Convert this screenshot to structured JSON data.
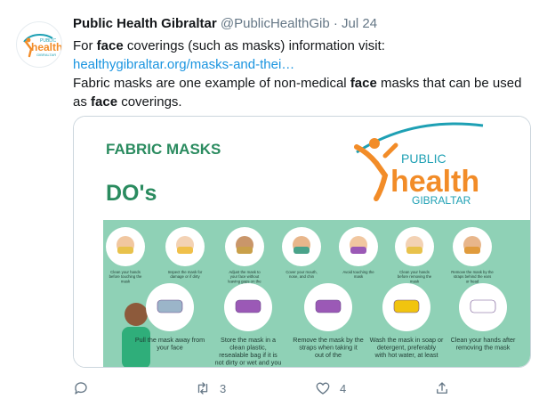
{
  "tweet": {
    "display_name": "Public Health Gibraltar",
    "handle": "@PublicHealthGib",
    "separator": "·",
    "date": "Jul 24",
    "line1_pre": "For ",
    "line1_bold": "face",
    "line1_post": " coverings (such as masks) information visit:",
    "link_text": "healthygibraltar.org/masks-and-thei…",
    "line3_pre": "Fabric masks are one example of non-medical ",
    "line3_bold1": "face",
    "line3_mid": " masks that can be used as ",
    "line3_bold2": "face",
    "line3_post": " coverings."
  },
  "avatar": {
    "logo_small": "PUBLIC",
    "logo_main": "health",
    "logo_sub": "GIBRALTAR"
  },
  "card": {
    "heading": "FABRIC MASKS",
    "subheading": "DO's",
    "logo_public": "PUBLIC",
    "logo_health": "health",
    "logo_gibraltar": "GIBRALTAR",
    "top_captions": [
      "Clean your hands before touching the mask",
      "Inspect the mask for damage or if dirty",
      "Adjust the mask to your face without leaving gaps on the sides",
      "Cover your mouth, nose, and chin",
      "Avoid touching the mask",
      "Clean your hands before removing the mask",
      "Remove the mask by the straps behind the ears or head"
    ],
    "bottom_captions": [
      "Pull the mask away from your face",
      "Store the mask in a clean plastic, resealable bag if it is not dirty or wet and you",
      "Remove the mask by the straps when taking it out of the",
      "Wash the mask in soap or detergent, preferably with hot water, at least",
      "Clean your hands after removing the mask"
    ]
  },
  "actions": {
    "reply_count": "",
    "retweet_count": "3",
    "like_count": "4"
  },
  "colors": {
    "link": "#1b95e0",
    "muted": "#657786",
    "infographic_green": "#8fd1b6",
    "brand_orange": "#f28c28",
    "brand_teal": "#1ea0b4"
  }
}
